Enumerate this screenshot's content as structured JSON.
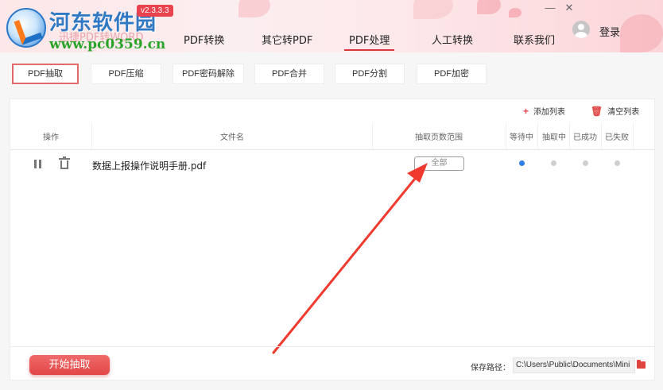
{
  "header": {
    "watermark_title": "河东软件园",
    "app_name": "迅捷PDF转WORD",
    "watermark_url": "www.pc0359.cn",
    "version": "v2.3.3.3",
    "nav": [
      "PDF转换",
      "其它转PDF",
      "PDF处理",
      "人工转换",
      "联系我们"
    ],
    "active_nav": "PDF处理",
    "login": "登录",
    "window_controls": [
      "minimize-icon",
      "close-icon"
    ],
    "window_symbols": [
      "—",
      "✕"
    ]
  },
  "tools": {
    "tabs": [
      "PDF抽取",
      "PDF压缩",
      "PDF密码解除",
      "PDF合并",
      "PDF分割",
      "PDF加密"
    ],
    "active": "PDF抽取"
  },
  "list_actions": {
    "add": "添加列表",
    "add_icon": "+",
    "clear": "清空列表",
    "clear_icon": "trash-icon"
  },
  "table": {
    "columns": [
      "操作",
      "文件名",
      "抽取页数范围",
      "等待中",
      "抽取中",
      "已成功",
      "已失败"
    ],
    "rows": [
      {
        "file_name": "数据上报操作说明手册.pdf",
        "range": "全部",
        "status": "等待中"
      }
    ]
  },
  "footer": {
    "start_button": "开始抽取",
    "save_label": "保存路径：",
    "save_path": "C:\\Users\\Public\\Documents\\Mini"
  },
  "colors": {
    "accent": "#e24646",
    "active_status_dot": "#2e7ee6",
    "annotation_arrow": "#f03a2e"
  }
}
